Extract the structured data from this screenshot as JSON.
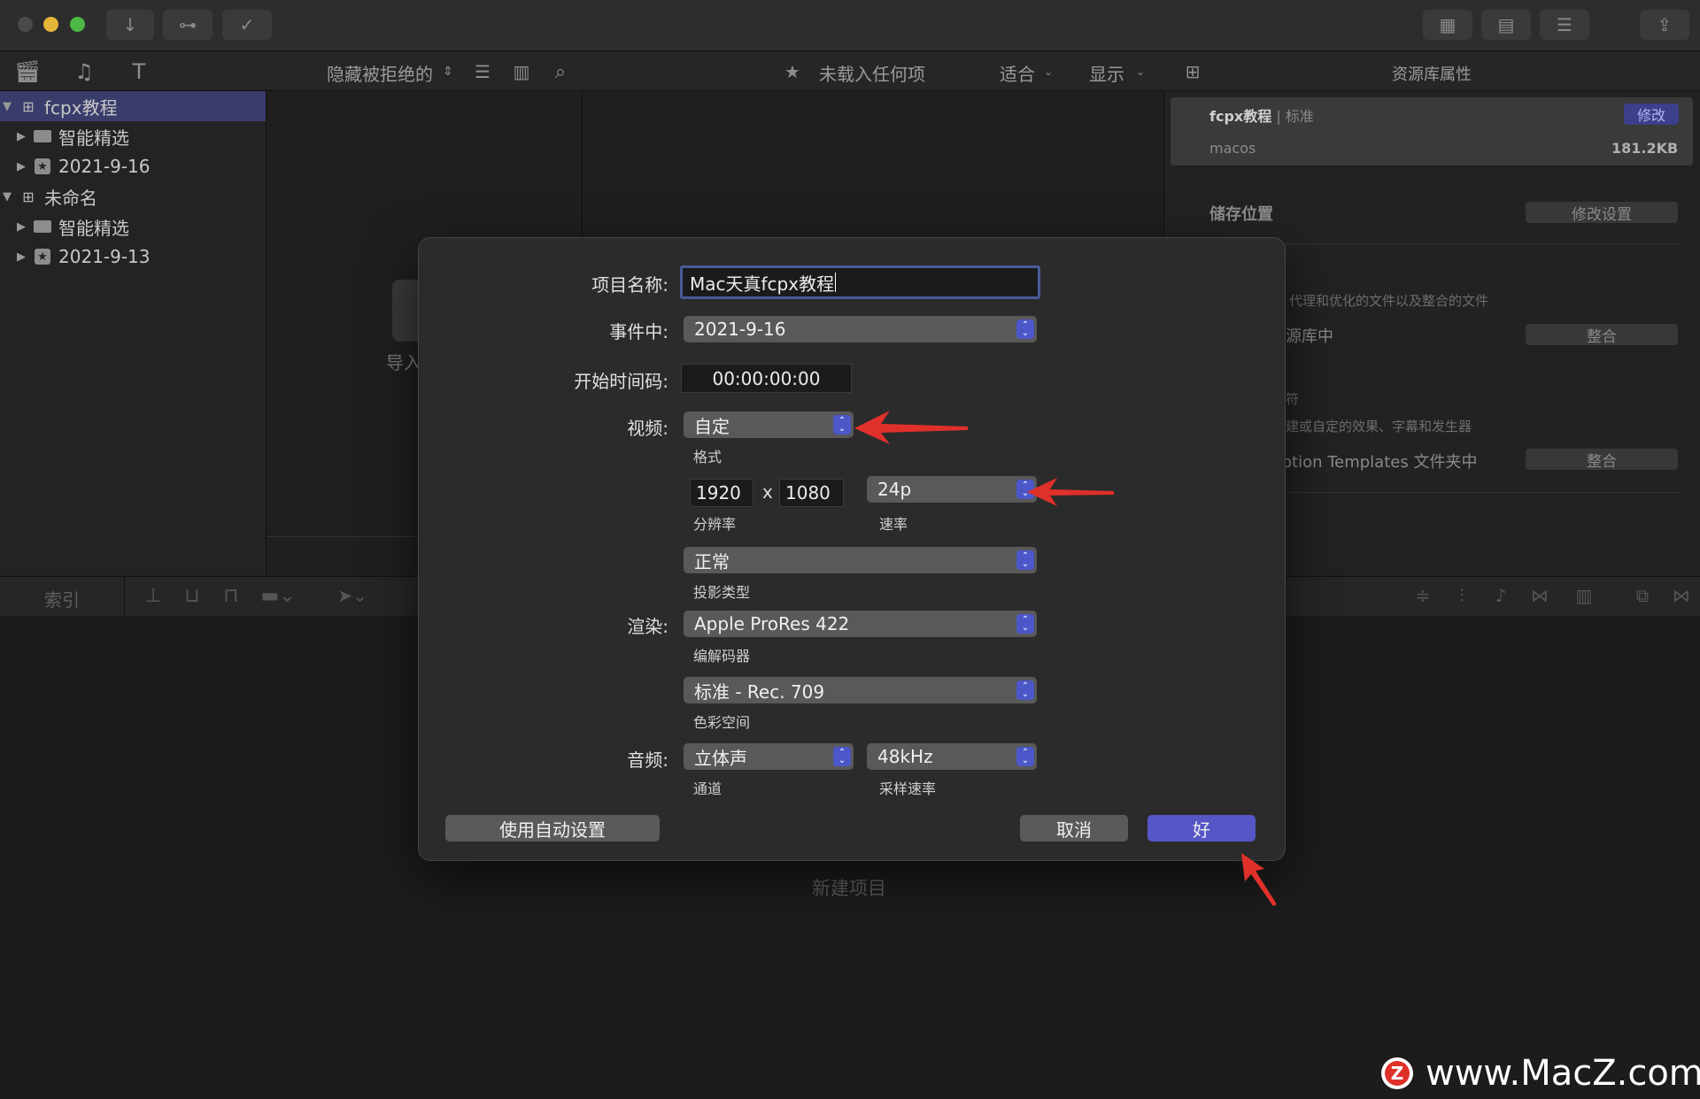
{
  "toolbar": {
    "hide_rejected": "隐藏被拒绝的",
    "viewer_title": "未载入任何项",
    "fit_label": "适合",
    "show_label": "显示",
    "inspector_title": "资源库属性"
  },
  "sidebar": {
    "items": [
      {
        "label": "fcpx教程",
        "type": "library"
      },
      {
        "label": "智能精选",
        "type": "folder"
      },
      {
        "label": "2021-9-16",
        "type": "event"
      },
      {
        "label": "未命名",
        "type": "library"
      },
      {
        "label": "智能精选",
        "type": "folder"
      },
      {
        "label": "2021-9-13",
        "type": "event"
      }
    ]
  },
  "browser": {
    "import_partial": "导入"
  },
  "inspector": {
    "library_name": "fcpx教程",
    "library_sep": " | ",
    "library_type": "标准",
    "modify_label": "修改",
    "library_location": "macos",
    "library_size": "181.2KB",
    "storage_label": "储存位置",
    "modify_settings": "修改设置",
    "media_desc": "代理和优化的文件以及整合的文件",
    "media_partial": "源库中",
    "consolidate_1": "整合",
    "effects_partial": "符",
    "effects_desc": "建或自定的效果、字幕和发生器",
    "motion_partial": "otion Templates 文件夹中",
    "consolidate_2": "整合"
  },
  "timeline": {
    "index_label": "索引",
    "new_project": "新建项目"
  },
  "dialog": {
    "project_name_label": "项目名称:",
    "project_name_value": "Mac天真fcpx教程",
    "event_label": "事件中:",
    "event_value": "2021-9-16",
    "start_timecode_label": "开始时间码:",
    "start_timecode_value": "00:00:00:00",
    "video_label": "视频:",
    "video_format_value": "自定",
    "format_sub": "格式",
    "res_width": "1920",
    "res_x": "x",
    "res_height": "1080",
    "resolution_sub": "分辨率",
    "rate_value": "24p",
    "rate_sub": "速率",
    "projection_value": "正常",
    "projection_sub": "投影类型",
    "render_label": "渲染:",
    "codec_value": "Apple ProRes 422",
    "codec_sub": "编解码器",
    "colorspace_value": "标准 - Rec. 709",
    "colorspace_sub": "色彩空间",
    "audio_label": "音频:",
    "channels_value": "立体声",
    "channels_sub": "通道",
    "samplerate_value": "48kHz",
    "samplerate_sub": "采样速率",
    "auto_settings_button": "使用自动设置",
    "cancel_button": "取消",
    "ok_button": "好"
  },
  "watermark": {
    "text": "www.MacZ.com",
    "logo_letter": "Z"
  },
  "colors": {
    "accent": "#5656c7",
    "stepper": "#4c57c9",
    "selection": "#3a3d6b",
    "annotation_red": "#e0302a"
  }
}
